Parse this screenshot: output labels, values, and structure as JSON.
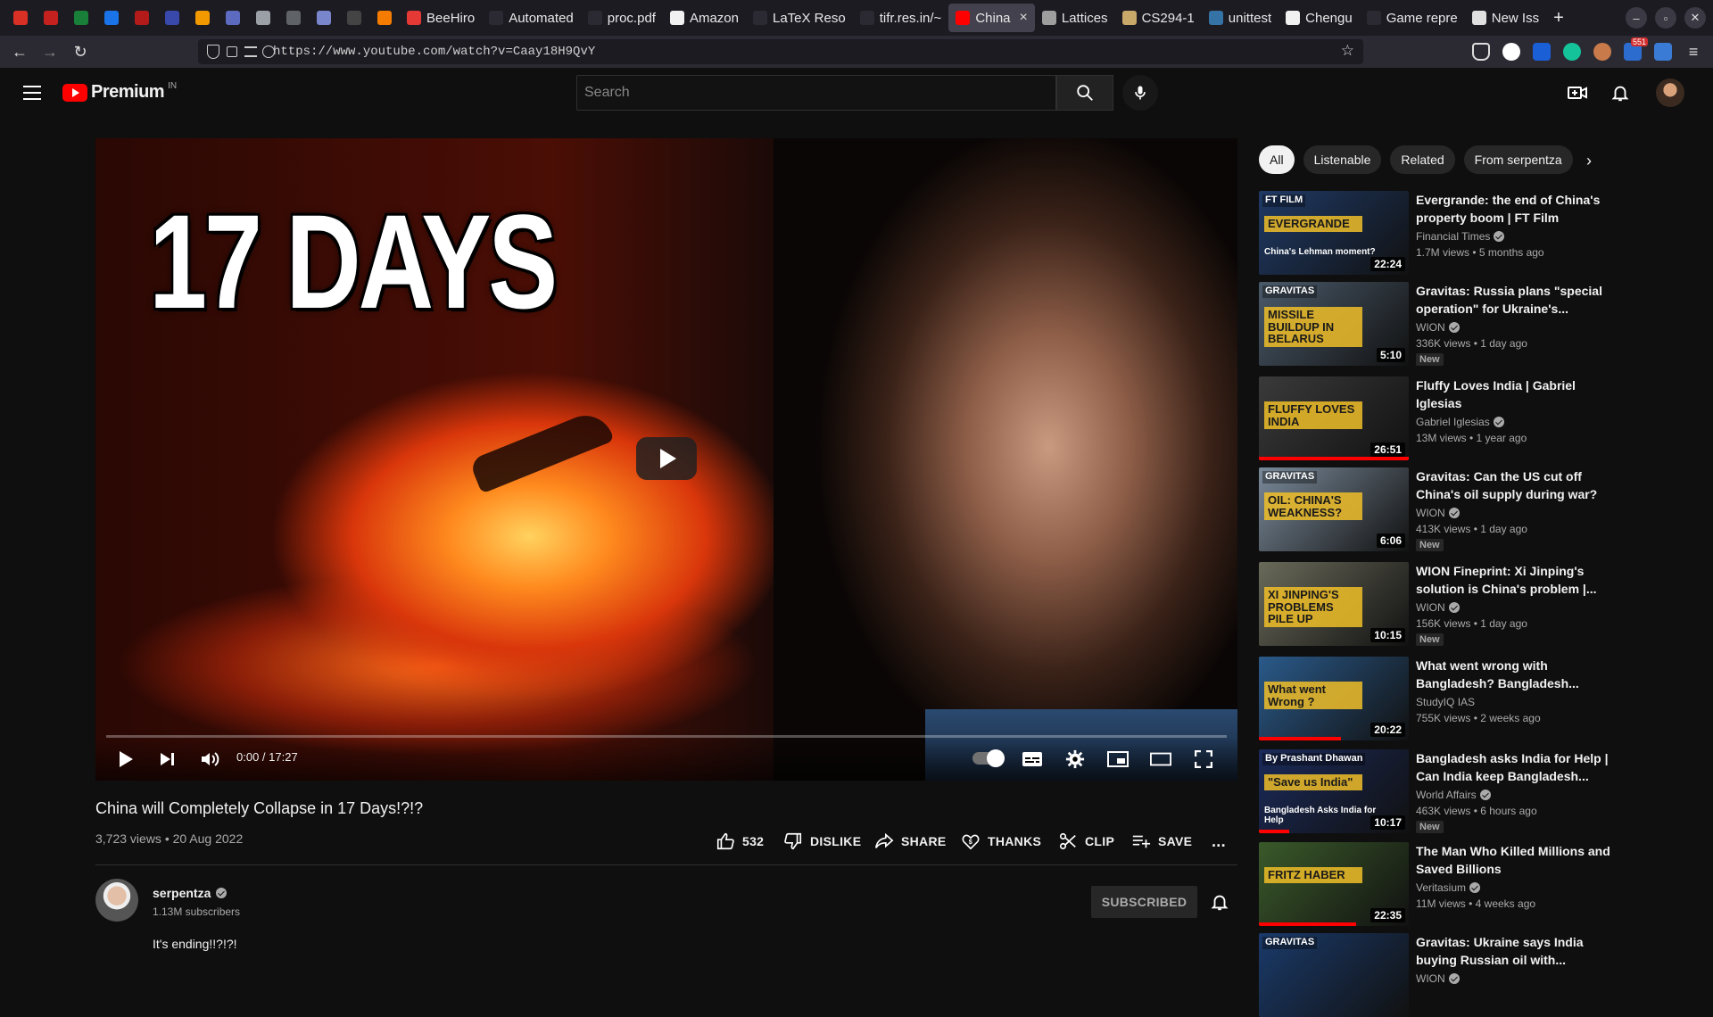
{
  "browser": {
    "tabs": [
      {
        "title": "",
        "favicon_color": "#d93025",
        "pinned": true
      },
      {
        "title": "",
        "favicon_color": "#c5221f",
        "pinned": true
      },
      {
        "title": "",
        "favicon_color": "#188038",
        "pinned": true
      },
      {
        "title": "",
        "favicon_color": "#1a73e8",
        "pinned": true
      },
      {
        "title": "",
        "favicon_color": "#b31b1b",
        "pinned": true
      },
      {
        "title": "",
        "favicon_color": "#3949ab",
        "pinned": true
      },
      {
        "title": "",
        "favicon_color": "#f29900",
        "pinned": true
      },
      {
        "title": "",
        "favicon_color": "#5c6bc0",
        "pinned": true
      },
      {
        "title": "",
        "favicon_color": "#9aa0a6",
        "pinned": true
      },
      {
        "title": "",
        "favicon_color": "#5f6368",
        "pinned": true
      },
      {
        "title": "",
        "favicon_color": "#7986cb",
        "pinned": true
      },
      {
        "title": "",
        "favicon_color": "#444444",
        "pinned": true
      },
      {
        "title": "",
        "favicon_color": "#f57c00",
        "pinned": true
      },
      {
        "title": "BeeHiro",
        "favicon_color": "#e53935",
        "pinned": false
      },
      {
        "title": "Automated",
        "favicon_color": "#2b2a33",
        "pinned": false
      },
      {
        "title": "proc.pdf",
        "favicon_color": "#2b2a33",
        "pinned": false
      },
      {
        "title": "Amazon",
        "favicon_color": "#f1f1f1",
        "pinned": false
      },
      {
        "title": "LaTeX Reso",
        "favicon_color": "#2b2a33",
        "pinned": false
      },
      {
        "title": "tifr.res.in/~",
        "favicon_color": "#2b2a33",
        "pinned": false
      },
      {
        "title": "China",
        "favicon_color": "#ff0000",
        "pinned": false,
        "active": true
      },
      {
        "title": "Lattices",
        "favicon_color": "#9e9e9e",
        "pinned": false
      },
      {
        "title": "CS294-1",
        "favicon_color": "#c8a96a",
        "pinned": false
      },
      {
        "title": "unittest",
        "favicon_color": "#3572a5",
        "pinned": false
      },
      {
        "title": "Chengu",
        "favicon_color": "#f1f1f1",
        "pinned": false
      },
      {
        "title": "Game repre",
        "favicon_color": "#2b2a33",
        "pinned": false
      },
      {
        "title": "New Iss",
        "favicon_color": "#e0e0e0",
        "pinned": false
      }
    ],
    "new_tab_label": "+",
    "url": "https://www.youtube.com/watch?v=Caay18H9QvY",
    "notif_badge": "551"
  },
  "youtube": {
    "logo_word": "Premium",
    "country_code": "IN",
    "search_placeholder": "Search"
  },
  "video": {
    "thumbnail_text": "17 DAYS",
    "time_display": "0:00 / 17:27",
    "progress_fraction": 0.0,
    "title": "China will Completely Collapse in 17 Days!?!?",
    "views_date": "3,723 views • 20 Aug 2022",
    "actions": {
      "like_count": "532",
      "dislike": "DISLIKE",
      "share": "SHARE",
      "thanks": "THANKS",
      "clip": "CLIP",
      "save": "SAVE",
      "more": "..."
    },
    "channel": {
      "name": "serpentza",
      "subscribers": "1.13M subscribers",
      "subscribe_label": "SUBSCRIBED"
    },
    "description": "It's ending!!?!?!"
  },
  "sidebar": {
    "chips": [
      "All",
      "Listenable",
      "Related",
      "From serpentza"
    ],
    "recommendations": [
      {
        "title": "Evergrande: the end of China's property boom | FT Film",
        "channel": "Financial Times",
        "verified": true,
        "stats": "1.7M views • 5 months ago",
        "duration": "22:24",
        "new": false,
        "thumb_text": "EVERGRANDE",
        "thumb_sub": "China's Lehman moment?",
        "thumb_tag": "FT FILM",
        "thumb_bg": "#1f3a66",
        "watched_fraction": 0
      },
      {
        "title": "Gravitas: Russia plans \"special operation\" for Ukraine's...",
        "channel": "WION",
        "verified": true,
        "stats": "336K views • 1 day ago",
        "duration": "5:10",
        "new": true,
        "thumb_text": "MISSILE BUILDUP IN BELARUS",
        "thumb_tag": "GRAVITAS",
        "thumb_bg": "#4a5a6a",
        "watched_fraction": 0
      },
      {
        "title": "Fluffy Loves India | Gabriel Iglesias",
        "channel": "Gabriel Iglesias",
        "verified": true,
        "stats": "13M views • 1 year ago",
        "duration": "26:51",
        "new": false,
        "thumb_text": "FLUFFY LOVES INDIA",
        "thumb_bg": "#3a3a3a",
        "watched_fraction": 1.0
      },
      {
        "title": "Gravitas: Can the US cut off China's oil supply during war?",
        "channel": "WION",
        "verified": true,
        "stats": "413K views • 1 day ago",
        "duration": "6:06",
        "new": true,
        "thumb_text": "OIL: CHINA'S WEAKNESS?",
        "thumb_tag": "GRAVITAS",
        "thumb_bg": "#7a8a9a",
        "watched_fraction": 0
      },
      {
        "title": "WION Fineprint: Xi Jinping's solution is China's problem |...",
        "channel": "WION",
        "verified": true,
        "stats": "156K views • 1 day ago",
        "duration": "10:15",
        "new": true,
        "thumb_text": "XI JINPING'S PROBLEMS PILE UP",
        "thumb_bg": "#6a6a5a",
        "watched_fraction": 0
      },
      {
        "title": "What went wrong with Bangladesh? Bangladesh...",
        "channel": "StudyIQ IAS",
        "verified": false,
        "stats": "755K views • 2 weeks ago",
        "duration": "20:22",
        "new": false,
        "thumb_text": "What went Wrong ?",
        "thumb_bg": "#2a5a8a",
        "watched_fraction": 0.55
      },
      {
        "title": "Bangladesh asks India for Help | Can India keep Bangladesh...",
        "channel": "World Affairs",
        "verified": true,
        "stats": "463K views • 6 hours ago",
        "duration": "10:17",
        "new": true,
        "thumb_text": "\"Save us India\"",
        "thumb_sub": "Bangladesh Asks India for Help",
        "thumb_tag": "By Prashant Dhawan",
        "thumb_bg": "#1a2a5a",
        "watched_fraction": 0.2
      },
      {
        "title": "The Man Who Killed Millions and Saved Billions",
        "channel": "Veritasium",
        "verified": true,
        "stats": "11M views • 4 weeks ago",
        "duration": "22:35",
        "new": false,
        "thumb_text": "FRITZ HABER",
        "thumb_bg": "#3a5a2a",
        "watched_fraction": 0.65
      },
      {
        "title": "Gravitas: Ukraine says India buying Russian oil with...",
        "channel": "WION",
        "verified": true,
        "stats": "",
        "duration": "",
        "new": false,
        "thumb_text": "",
        "thumb_tag": "GRAVITAS",
        "thumb_bg": "#1a3a6a",
        "watched_fraction": 0
      }
    ]
  },
  "colors": {
    "accent": "#ff0000",
    "bg": "#0f0f0f"
  }
}
